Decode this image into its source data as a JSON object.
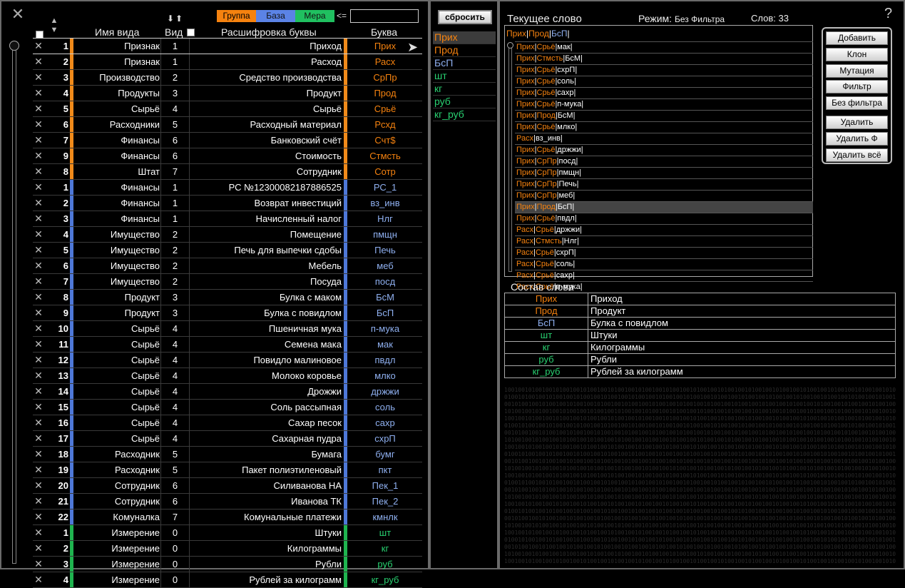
{
  "left": {
    "filters": {
      "group": "Группа",
      "base": "База",
      "measure": "Мера",
      "lte": "<=",
      "search_value": ""
    },
    "headers": {
      "kind": "Имя вида",
      "vid": "Вид",
      "desc": "Расшифровка буквы",
      "letter": "Буква"
    },
    "sort_arrows": "⬇⬆",
    "rows": [
      {
        "group": "group",
        "num": "1",
        "kind": "Признак",
        "vid": "1",
        "desc": "Приход",
        "letter": "Прих"
      },
      {
        "group": "group",
        "num": "2",
        "kind": "Признак",
        "vid": "1",
        "desc": "Расход",
        "letter": "Расх"
      },
      {
        "group": "group",
        "num": "3",
        "kind": "Производство",
        "vid": "2",
        "desc": "Средство производства",
        "letter": "СрПр"
      },
      {
        "group": "group",
        "num": "4",
        "kind": "Продукты",
        "vid": "3",
        "desc": "Продукт",
        "letter": "Прод"
      },
      {
        "group": "group",
        "num": "5",
        "kind": "Сырьё",
        "vid": "4",
        "desc": "Сырьё",
        "letter": "Срьё"
      },
      {
        "group": "group",
        "num": "6",
        "kind": "Расходники",
        "vid": "5",
        "desc": "Расходный материал",
        "letter": "Рсхд"
      },
      {
        "group": "group",
        "num": "7",
        "kind": "Финансы",
        "vid": "6",
        "desc": "Банковский счёт",
        "letter": "Счт$"
      },
      {
        "group": "group",
        "num": "9",
        "kind": "Финансы",
        "vid": "6",
        "desc": "Стоимость",
        "letter": "Стмсть"
      },
      {
        "group": "group",
        "num": "8",
        "kind": "Штат",
        "vid": "7",
        "desc": "Сотрудник",
        "letter": "Сотр"
      },
      {
        "group": "base",
        "num": "1",
        "kind": "Финансы",
        "vid": "1",
        "desc": "РС №12300082187886525",
        "letter": "РС_1"
      },
      {
        "group": "base",
        "num": "2",
        "kind": "Финансы",
        "vid": "1",
        "desc": "Возврат инвестиций",
        "letter": "вз_инв"
      },
      {
        "group": "base",
        "num": "3",
        "kind": "Финансы",
        "vid": "1",
        "desc": "Начисленный налог",
        "letter": "Нлг"
      },
      {
        "group": "base",
        "num": "4",
        "kind": "Имущество",
        "vid": "2",
        "desc": "Помещение",
        "letter": "пмщн"
      },
      {
        "group": "base",
        "num": "5",
        "kind": "Имущество",
        "vid": "2",
        "desc": "Печь для выпечки сдобы",
        "letter": "Печь"
      },
      {
        "group": "base",
        "num": "6",
        "kind": "Имущество",
        "vid": "2",
        "desc": "Мебель",
        "letter": "меб"
      },
      {
        "group": "base",
        "num": "7",
        "kind": "Имущество",
        "vid": "2",
        "desc": "Посуда",
        "letter": "посд"
      },
      {
        "group": "base",
        "num": "8",
        "kind": "Продукт",
        "vid": "3",
        "desc": "Булка с маком",
        "letter": "БсМ"
      },
      {
        "group": "base",
        "num": "9",
        "kind": "Продукт",
        "vid": "3",
        "desc": "Булка с повидлом",
        "letter": "БсП"
      },
      {
        "group": "base",
        "num": "10",
        "kind": "Сырьё",
        "vid": "4",
        "desc": "Пшеничная мука",
        "letter": "п-мука"
      },
      {
        "group": "base",
        "num": "11",
        "kind": "Сырьё",
        "vid": "4",
        "desc": "Семена мака",
        "letter": "мак"
      },
      {
        "group": "base",
        "num": "12",
        "kind": "Сырьё",
        "vid": "4",
        "desc": "Повидло малиновое",
        "letter": "пвдл"
      },
      {
        "group": "base",
        "num": "13",
        "kind": "Сырьё",
        "vid": "4",
        "desc": "Молоко коровье",
        "letter": "млко"
      },
      {
        "group": "base",
        "num": "14",
        "kind": "Сырьё",
        "vid": "4",
        "desc": "Дрожжи",
        "letter": "држжи"
      },
      {
        "group": "base",
        "num": "15",
        "kind": "Сырьё",
        "vid": "4",
        "desc": "Соль рассыпная",
        "letter": "соль"
      },
      {
        "group": "base",
        "num": "16",
        "kind": "Сырьё",
        "vid": "4",
        "desc": "Сахар песок",
        "letter": "сахр"
      },
      {
        "group": "base",
        "num": "17",
        "kind": "Сырьё",
        "vid": "4",
        "desc": "Сахарная пудра",
        "letter": "схрП"
      },
      {
        "group": "base",
        "num": "18",
        "kind": "Расходник",
        "vid": "5",
        "desc": "Бумага",
        "letter": "бумг"
      },
      {
        "group": "base",
        "num": "19",
        "kind": "Расходник",
        "vid": "5",
        "desc": "Пакет полиэтиленовый",
        "letter": "пкт"
      },
      {
        "group": "base",
        "num": "20",
        "kind": "Сотрудник",
        "vid": "6",
        "desc": "Силиванова НА",
        "letter": "Пек_1"
      },
      {
        "group": "base",
        "num": "21",
        "kind": "Сотрудник",
        "vid": "6",
        "desc": "Иванова ТК",
        "letter": "Пек_2"
      },
      {
        "group": "base",
        "num": "22",
        "kind": "Комуналка",
        "vid": "7",
        "desc": "Комунальные платежи",
        "letter": "кмнлк"
      },
      {
        "group": "measure",
        "num": "1",
        "kind": "Измерение",
        "vid": "0",
        "desc": "Штуки",
        "letter": "шт"
      },
      {
        "group": "measure",
        "num": "2",
        "kind": "Измерение",
        "vid": "0",
        "desc": "Килограммы",
        "letter": "кг"
      },
      {
        "group": "measure",
        "num": "3",
        "kind": "Измерение",
        "vid": "0",
        "desc": "Рубли",
        "letter": "руб"
      },
      {
        "group": "measure",
        "num": "4",
        "kind": "Измерение",
        "vid": "0",
        "desc": "Рублей за килограмм",
        "letter": "кг_руб"
      }
    ]
  },
  "middle": {
    "reset_label": "сбросить",
    "items": [
      {
        "text": "Прих",
        "color": "o",
        "selected": true
      },
      {
        "text": "Прод",
        "color": "o",
        "selected": false
      },
      {
        "text": "БсП",
        "color": "b",
        "selected": false
      },
      {
        "text": "шт",
        "color": "g",
        "selected": false
      },
      {
        "text": "кг",
        "color": "g",
        "selected": false
      },
      {
        "text": "руб",
        "color": "g",
        "selected": false
      },
      {
        "text": "кг_руб",
        "color": "g",
        "selected": false
      }
    ]
  },
  "right": {
    "title": "Текущее слово",
    "mode_label": "Режим:",
    "mode_value": "Без Фильтра",
    "count_label": "Слов: 33",
    "help": "?",
    "current_word": [
      {
        "t": "Прих",
        "c": "o"
      },
      {
        "t": "|",
        "c": "w"
      },
      {
        "t": "Прод",
        "c": "o"
      },
      {
        "t": "|",
        "c": "w"
      },
      {
        "t": "БсП",
        "c": "b"
      },
      {
        "t": "|",
        "c": "w"
      }
    ],
    "words": [
      [
        {
          "t": "Прих",
          "c": "o"
        },
        {
          "t": "|",
          "c": "w"
        },
        {
          "t": "Срьё",
          "c": "o"
        },
        {
          "t": "|мак|",
          "c": "w"
        }
      ],
      [
        {
          "t": "Прих",
          "c": "o"
        },
        {
          "t": "|",
          "c": "w"
        },
        {
          "t": "Стмсть",
          "c": "o"
        },
        {
          "t": "|БсМ|",
          "c": "w"
        }
      ],
      [
        {
          "t": "Прих",
          "c": "o"
        },
        {
          "t": "|",
          "c": "w"
        },
        {
          "t": "Срьё",
          "c": "o"
        },
        {
          "t": "|схрП|",
          "c": "w"
        }
      ],
      [
        {
          "t": "Прих",
          "c": "o"
        },
        {
          "t": "|",
          "c": "w"
        },
        {
          "t": "Срьё",
          "c": "o"
        },
        {
          "t": "|соль|",
          "c": "w"
        }
      ],
      [
        {
          "t": "Прих",
          "c": "o"
        },
        {
          "t": "|",
          "c": "w"
        },
        {
          "t": "Срьё",
          "c": "o"
        },
        {
          "t": "|сахр|",
          "c": "w"
        }
      ],
      [
        {
          "t": "Прих",
          "c": "o"
        },
        {
          "t": "|",
          "c": "w"
        },
        {
          "t": "Срьё",
          "c": "o"
        },
        {
          "t": "|п-мука|",
          "c": "w"
        }
      ],
      [
        {
          "t": "Прих",
          "c": "o"
        },
        {
          "t": "|",
          "c": "w"
        },
        {
          "t": "Прод",
          "c": "o"
        },
        {
          "t": "|БсМ|",
          "c": "w"
        }
      ],
      [
        {
          "t": "Прих",
          "c": "o"
        },
        {
          "t": "|",
          "c": "w"
        },
        {
          "t": "Срьё",
          "c": "o"
        },
        {
          "t": "|млко|",
          "c": "w"
        }
      ],
      [
        {
          "t": "Расх",
          "c": "o"
        },
        {
          "t": "|вз_инв|",
          "c": "w"
        }
      ],
      [
        {
          "t": "Прих",
          "c": "o"
        },
        {
          "t": "|",
          "c": "w"
        },
        {
          "t": "Срьё",
          "c": "o"
        },
        {
          "t": "|држжи|",
          "c": "w"
        }
      ],
      [
        {
          "t": "Прих",
          "c": "o"
        },
        {
          "t": "|",
          "c": "w"
        },
        {
          "t": "СрПр",
          "c": "o"
        },
        {
          "t": "|посд|",
          "c": "w"
        }
      ],
      [
        {
          "t": "Прих",
          "c": "o"
        },
        {
          "t": "|",
          "c": "w"
        },
        {
          "t": "СрПр",
          "c": "o"
        },
        {
          "t": "|пмщн|",
          "c": "w"
        }
      ],
      [
        {
          "t": "Прих",
          "c": "o"
        },
        {
          "t": "|",
          "c": "w"
        },
        {
          "t": "СрПр",
          "c": "o"
        },
        {
          "t": "|Печь|",
          "c": "w"
        }
      ],
      [
        {
          "t": "Прих",
          "c": "o"
        },
        {
          "t": "|",
          "c": "w"
        },
        {
          "t": "СрПр",
          "c": "o"
        },
        {
          "t": "|меб|",
          "c": "w"
        }
      ],
      [
        {
          "t": "Прих",
          "c": "o"
        },
        {
          "t": "|",
          "c": "w"
        },
        {
          "t": "Прод",
          "c": "o"
        },
        {
          "t": "|БсП|",
          "c": "w"
        }
      ],
      [
        {
          "t": "Прих",
          "c": "o"
        },
        {
          "t": "|",
          "c": "w"
        },
        {
          "t": "Срьё",
          "c": "o"
        },
        {
          "t": "|пвдл|",
          "c": "w"
        }
      ],
      [
        {
          "t": "Расх",
          "c": "o"
        },
        {
          "t": "|",
          "c": "w"
        },
        {
          "t": "Срьё",
          "c": "o"
        },
        {
          "t": "|држжи|",
          "c": "w"
        }
      ],
      [
        {
          "t": "Расх",
          "c": "o"
        },
        {
          "t": "|",
          "c": "w"
        },
        {
          "t": "Стмсть",
          "c": "o"
        },
        {
          "t": "|Нлг|",
          "c": "w"
        }
      ],
      [
        {
          "t": "Расх",
          "c": "o"
        },
        {
          "t": "|",
          "c": "w"
        },
        {
          "t": "Срьё",
          "c": "o"
        },
        {
          "t": "|схрП|",
          "c": "w"
        }
      ],
      [
        {
          "t": "Расх",
          "c": "o"
        },
        {
          "t": "|",
          "c": "w"
        },
        {
          "t": "Срьё",
          "c": "o"
        },
        {
          "t": "|соль|",
          "c": "w"
        }
      ],
      [
        {
          "t": "Расх",
          "c": "o"
        },
        {
          "t": "|",
          "c": "w"
        },
        {
          "t": "Срьё",
          "c": "o"
        },
        {
          "t": "|сахр|",
          "c": "w"
        }
      ],
      [
        {
          "t": "Расх",
          "c": "o"
        },
        {
          "t": "|",
          "c": "w"
        },
        {
          "t": "Срьё",
          "c": "o"
        },
        {
          "t": "|п-мука|",
          "c": "w"
        }
      ]
    ],
    "selected_word_index": 14,
    "buttons": [
      "Добавить",
      "Клон",
      "Мутация",
      "Фильтр",
      "Без фильтра",
      "Удалить",
      "Удалить Ф",
      "Удалить всё"
    ],
    "composition_title": "Состав слова",
    "composition": [
      {
        "k": "Прих",
        "c": "o",
        "v": "Приход"
      },
      {
        "k": "Прод",
        "c": "o",
        "v": "Продукт"
      },
      {
        "k": "БсП",
        "c": "b",
        "v": "Булка с повидлом"
      },
      {
        "k": "шт",
        "c": "g",
        "v": "Штуки"
      },
      {
        "k": "кг",
        "c": "g",
        "v": "Килограммы"
      },
      {
        "k": "руб",
        "c": "g",
        "v": "Рубли"
      },
      {
        "k": "кг_руб",
        "c": "g",
        "v": "Рублей за килограмм"
      }
    ]
  },
  "colors": {
    "group": "#f5820f",
    "base": "#5b83e6",
    "measure": "#20c060"
  },
  "icons": {
    "logo": "x-logo-icon",
    "sort": "sort-updown-icon",
    "delete": "delete-x-icon",
    "pointer": "play-arrow-icon",
    "help": "help-icon"
  }
}
